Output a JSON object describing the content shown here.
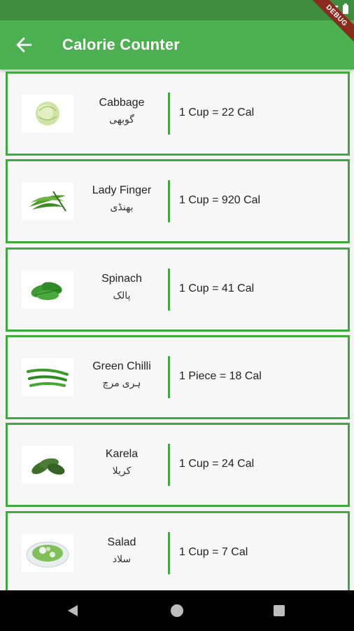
{
  "app_bar": {
    "title": "Calorie Counter"
  },
  "debug_banner": "DEBUG",
  "items": [
    {
      "name": "Cabbage",
      "urdu": "گوبھی",
      "calories": "1 Cup = 22 Cal",
      "icon": "cabbage-icon"
    },
    {
      "name": "Lady Finger",
      "urdu": "بھنڈی",
      "calories": "1 Cup = 920 Cal",
      "icon": "lady-finger-icon"
    },
    {
      "name": "Spinach",
      "urdu": "پالک",
      "calories": "1 Cup = 41 Cal",
      "icon": "spinach-icon"
    },
    {
      "name": "Green Chilli",
      "urdu": "ہری مرچ",
      "calories": "1 Piece = 18 Cal",
      "icon": "green-chilli-icon"
    },
    {
      "name": "Karela",
      "urdu": "کریلا",
      "calories": "1 Cup = 24 Cal",
      "icon": "karela-icon"
    },
    {
      "name": "Salad",
      "urdu": "سلاد",
      "calories": "1 Cup = 7 Cal",
      "icon": "salad-icon"
    }
  ],
  "colors": {
    "primary": "#4caf50",
    "status_bar": "#3e8e3f",
    "accent_border": "#3eaa3b"
  }
}
